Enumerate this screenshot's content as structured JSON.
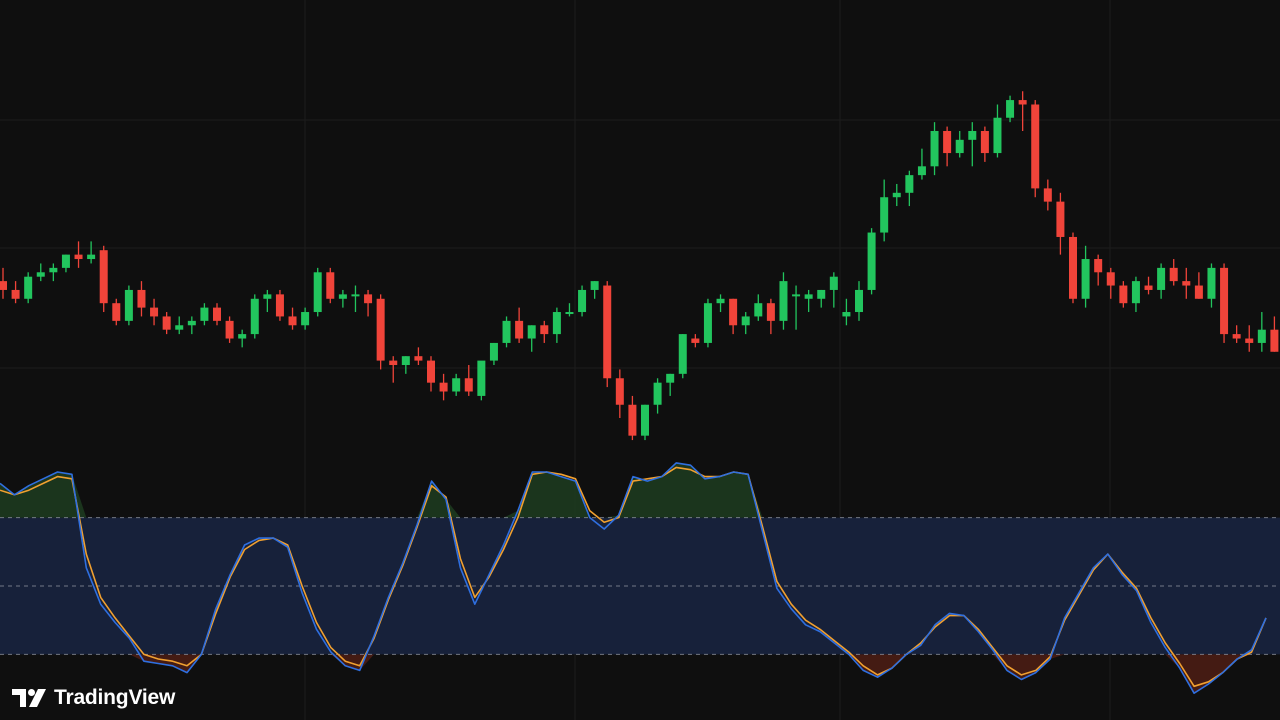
{
  "brand": {
    "name": "TradingView",
    "logo": "tradingview-logo-icon"
  },
  "colors": {
    "background": "#0f0f0f",
    "grid": "#1c1c1c",
    "up": "#22c55e",
    "down": "#f0443a",
    "k_line": "#2f6fe0",
    "d_line": "#f0a030",
    "band_fill": "#17213a",
    "band_border": "#8a8f9c",
    "overbought_fill": "#1d3a1f",
    "oversold_fill": "#4a1d14"
  },
  "chart_data": [
    {
      "type": "candlestick",
      "x": [
        1,
        2,
        3,
        4,
        5,
        6,
        7,
        8,
        9,
        10,
        11,
        12,
        13,
        14,
        15,
        16,
        17,
        18,
        19,
        20,
        21,
        22,
        23,
        24,
        25,
        26,
        27,
        28,
        29,
        30,
        31,
        32,
        33,
        34,
        35,
        36,
        37,
        38,
        39,
        40,
        41,
        42,
        43,
        44,
        45,
        46,
        47,
        48,
        49,
        50,
        51,
        52,
        53,
        54,
        55,
        56,
        57,
        58,
        59,
        60,
        61,
        62,
        63,
        64,
        65,
        66,
        67,
        68,
        69,
        70,
        71,
        72,
        73,
        74,
        75,
        76,
        77,
        78,
        79,
        80,
        81,
        82,
        83,
        84,
        85,
        86,
        87,
        88,
        89,
        90,
        91,
        92,
        93,
        94,
        95,
        96,
        97,
        98,
        99,
        100,
        101,
        102
      ],
      "ohlc": [
        [
          76,
          79,
          72,
          74
        ],
        [
          74,
          76,
          71,
          72
        ],
        [
          72,
          78,
          71,
          77
        ],
        [
          77,
          80,
          76,
          78
        ],
        [
          78,
          80,
          76,
          79
        ],
        [
          79,
          82,
          78,
          82
        ],
        [
          82,
          85,
          79,
          81
        ],
        [
          81,
          85,
          80,
          82
        ],
        [
          83,
          84,
          69,
          71
        ],
        [
          71,
          72,
          66,
          67
        ],
        [
          67,
          75,
          66,
          74
        ],
        [
          74,
          76,
          68,
          70
        ],
        [
          70,
          72,
          66,
          68
        ],
        [
          68,
          69,
          64,
          65
        ],
        [
          65,
          68,
          64,
          66
        ],
        [
          66,
          68,
          64,
          67
        ],
        [
          67,
          71,
          66,
          70
        ],
        [
          70,
          71,
          66,
          67
        ],
        [
          67,
          68,
          62,
          63
        ],
        [
          63,
          65,
          61,
          64
        ],
        [
          64,
          73,
          63,
          72
        ],
        [
          72,
          74,
          69,
          73
        ],
        [
          73,
          74,
          67,
          68
        ],
        [
          68,
          70,
          65,
          66
        ],
        [
          66,
          70,
          65,
          69
        ],
        [
          69,
          79,
          68,
          78
        ],
        [
          78,
          79,
          71,
          72
        ],
        [
          72,
          74,
          70,
          73
        ],
        [
          73,
          75,
          69,
          73
        ],
        [
          73,
          74,
          68,
          71
        ],
        [
          72,
          73,
          56,
          58
        ],
        [
          58,
          59,
          53,
          57
        ],
        [
          57,
          59,
          55,
          59
        ],
        [
          59,
          61,
          57,
          58
        ],
        [
          58,
          59,
          51,
          53
        ],
        [
          53,
          55,
          49,
          51
        ],
        [
          51,
          55,
          50,
          54
        ],
        [
          54,
          57,
          50,
          51
        ],
        [
          50,
          57,
          49,
          58
        ],
        [
          58,
          62,
          57,
          62
        ],
        [
          62,
          68,
          61,
          67
        ],
        [
          67,
          70,
          62,
          63
        ],
        [
          63,
          66,
          60,
          66
        ],
        [
          66,
          67,
          62,
          64
        ],
        [
          64,
          70,
          62,
          69
        ],
        [
          69,
          71,
          68,
          69
        ],
        [
          69,
          75,
          68,
          74
        ],
        [
          74,
          76,
          72,
          76
        ],
        [
          75,
          76,
          52,
          54
        ],
        [
          54,
          56,
          45,
          48
        ],
        [
          48,
          50,
          40,
          41
        ],
        [
          41,
          48,
          40,
          48
        ],
        [
          48,
          54,
          46,
          53
        ],
        [
          53,
          55,
          50,
          55
        ],
        [
          55,
          64,
          54,
          64
        ],
        [
          63,
          64,
          61,
          62
        ],
        [
          62,
          72,
          61,
          71
        ],
        [
          71,
          73,
          69,
          72
        ],
        [
          72,
          72,
          64,
          66
        ],
        [
          66,
          69,
          64,
          68
        ],
        [
          68,
          73,
          67,
          71
        ],
        [
          71,
          72,
          64,
          67
        ],
        [
          67,
          78,
          65,
          76
        ],
        [
          73,
          75,
          65,
          73
        ],
        [
          72,
          74,
          69,
          73
        ],
        [
          72,
          74,
          70,
          74
        ],
        [
          74,
          78,
          70,
          77
        ],
        [
          68,
          72,
          66,
          69
        ],
        [
          69,
          76,
          67,
          74
        ],
        [
          74,
          88,
          73,
          87
        ],
        [
          87,
          99,
          85,
          95
        ],
        [
          95,
          98,
          93,
          96
        ],
        [
          96,
          101,
          93,
          100
        ],
        [
          100,
          106,
          99,
          102
        ],
        [
          102,
          112,
          100,
          110
        ],
        [
          110,
          111,
          102,
          105
        ],
        [
          105,
          110,
          104,
          108
        ],
        [
          108,
          112,
          102,
          110
        ],
        [
          110,
          111,
          103,
          105
        ],
        [
          105,
          116,
          104,
          113
        ],
        [
          113,
          118,
          112,
          117
        ],
        [
          117,
          119,
          110,
          116
        ],
        [
          116,
          117,
          95,
          97
        ],
        [
          97,
          99,
          92,
          94
        ],
        [
          94,
          96,
          82,
          86
        ],
        [
          86,
          87,
          71,
          72
        ],
        [
          72,
          84,
          70,
          81
        ],
        [
          81,
          82,
          75,
          78
        ],
        [
          78,
          79,
          72,
          75
        ],
        [
          75,
          76,
          70,
          71
        ],
        [
          71,
          77,
          69,
          76
        ],
        [
          75,
          77,
          73,
          74
        ],
        [
          74,
          80,
          72,
          79
        ],
        [
          79,
          81,
          75,
          76
        ],
        [
          76,
          79,
          72,
          75
        ],
        [
          75,
          78,
          72,
          72
        ],
        [
          72,
          80,
          70,
          79
        ],
        [
          79,
          80,
          62,
          64
        ],
        [
          64,
          66,
          62,
          63
        ],
        [
          63,
          66,
          60,
          62
        ],
        [
          62,
          69,
          60,
          65
        ],
        [
          65,
          68,
          60,
          60
        ]
      ],
      "ylim": [
        45,
        122
      ]
    },
    {
      "type": "line",
      "x": [
        1,
        2,
        3,
        4,
        5,
        6,
        7,
        8,
        9,
        10,
        11,
        12,
        13,
        14,
        15,
        16,
        17,
        18,
        19,
        20,
        21,
        22,
        23,
        24,
        25,
        26,
        27,
        28,
        29,
        30,
        31,
        32,
        33,
        34,
        35,
        36,
        37,
        38,
        39,
        40,
        41,
        42,
        43,
        44,
        45,
        46,
        47,
        48,
        49,
        50,
        51,
        52,
        53,
        54,
        55,
        56,
        57,
        58,
        59,
        60,
        61,
        62,
        63,
        64,
        65,
        66,
        67,
        68,
        69,
        70,
        71,
        72,
        73,
        74,
        75,
        76,
        77,
        78,
        79,
        80,
        81,
        82,
        83,
        84,
        85,
        86,
        87,
        88,
        89,
        90,
        91,
        92,
        93,
        94,
        95,
        96,
        97,
        98,
        99,
        100,
        101,
        102
      ],
      "series": [
        {
          "key": "k",
          "values": [
            95,
            90,
            94,
            97,
            100,
            99,
            58,
            42,
            34,
            27,
            17,
            16,
            15,
            12,
            20,
            40,
            55,
            68,
            71,
            71,
            67,
            47,
            31,
            21,
            15,
            13,
            28,
            45,
            60,
            77,
            96,
            88,
            58,
            42,
            55,
            68,
            83,
            100,
            100,
            98,
            96,
            80,
            75,
            81,
            98,
            96,
            98,
            104,
            103,
            97,
            98,
            100,
            99,
            74,
            49,
            40,
            33,
            30,
            25,
            20,
            13,
            10,
            14,
            20,
            24,
            33,
            38,
            37,
            30,
            22,
            13,
            9,
            12,
            18,
            36,
            47,
            58,
            64,
            55,
            48,
            34,
            23,
            14,
            3,
            7,
            12,
            18,
            22,
            36
          ],
          "ylim": [
            0,
            100
          ]
        },
        {
          "key": "d",
          "values": [
            92,
            90,
            92,
            95,
            98,
            97,
            64,
            45,
            36,
            28,
            20,
            18,
            17,
            15,
            20,
            38,
            54,
            66,
            70,
            71,
            68,
            50,
            34,
            23,
            17,
            15,
            27,
            44,
            59,
            76,
            94,
            89,
            62,
            45,
            54,
            66,
            80,
            99,
            100,
            99,
            97,
            83,
            78,
            80,
            96,
            97,
            98,
            102,
            101,
            98,
            98,
            100,
            99,
            76,
            52,
            42,
            35,
            31,
            26,
            21,
            15,
            11,
            14,
            20,
            25,
            32,
            37,
            37,
            31,
            23,
            15,
            11,
            13,
            19,
            35,
            46,
            57,
            64,
            56,
            49,
            36,
            25,
            16,
            6,
            8,
            12,
            18,
            21,
            36
          ],
          "ylim": [
            0,
            100
          ]
        }
      ],
      "bands": [
        80,
        50,
        20
      ],
      "ylim": [
        0,
        100
      ]
    }
  ]
}
